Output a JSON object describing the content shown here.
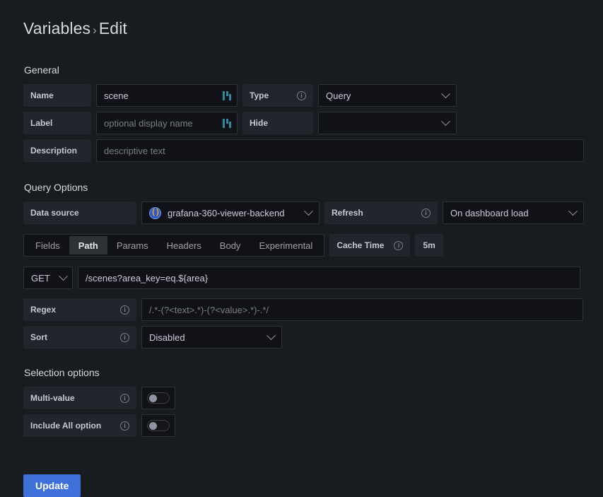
{
  "header": {
    "breadcrumb_root": "Variables",
    "separator": "›",
    "breadcrumb_current": "Edit"
  },
  "general": {
    "title": "General",
    "name": {
      "label": "Name",
      "value": "scene"
    },
    "type": {
      "label": "Type",
      "value": "Query",
      "has_info": true
    },
    "label_field": {
      "label": "Label",
      "value": "",
      "placeholder": "optional display name"
    },
    "hide": {
      "label": "Hide",
      "value": ""
    },
    "description": {
      "label": "Description",
      "value": "",
      "placeholder": "descriptive text"
    }
  },
  "query_options": {
    "title": "Query Options",
    "data_source": {
      "label": "Data source",
      "value": "grafana-360-viewer-backend",
      "icon": "infinity-datasource-icon"
    },
    "refresh": {
      "label": "Refresh",
      "value": "On dashboard load",
      "has_info": true
    },
    "tabs": [
      {
        "label": "Fields",
        "active": false
      },
      {
        "label": "Path",
        "active": true
      },
      {
        "label": "Params",
        "active": false
      },
      {
        "label": "Headers",
        "active": false
      },
      {
        "label": "Body",
        "active": false
      },
      {
        "label": "Experimental",
        "active": false
      }
    ],
    "cache_time": {
      "label": "Cache Time",
      "value": "5m"
    },
    "method": "GET",
    "url": "/scenes?area_key=eq.${area}",
    "regex": {
      "label": "Regex",
      "value": "",
      "placeholder": "/.*-(?<text>.*)-(?<value>.*)-.*/"
    },
    "sort": {
      "label": "Sort",
      "value": "Disabled"
    }
  },
  "selection_options": {
    "title": "Selection options",
    "multi_value": {
      "label": "Multi-value",
      "enabled": false
    },
    "include_all": {
      "label": "Include All option",
      "enabled": false
    }
  },
  "footer": {
    "update_label": "Update"
  },
  "colors": {
    "page_background": "#181b1f",
    "input_background": "#111217",
    "label_background": "#22252b",
    "primary_button": "#3d71d9",
    "variable_glyph": "#2e8a9b",
    "text_primary": "#ccccdc",
    "text_muted": "#7b7f86"
  }
}
